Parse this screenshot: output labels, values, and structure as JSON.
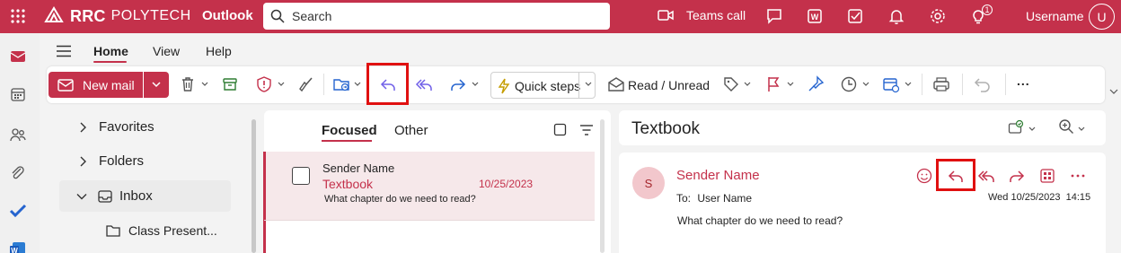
{
  "topbar": {
    "brand": "RRC",
    "brand_sub": "POLYTECH",
    "app_name": "Outlook",
    "search_placeholder": "Search",
    "teams_call": "Teams call",
    "notification_count": "1",
    "username": "Username",
    "avatar_initial": "U",
    "bg_color": "#c4314b"
  },
  "tabs": [
    {
      "label": "Home",
      "active": true
    },
    {
      "label": "View",
      "active": false
    },
    {
      "label": "Help",
      "active": false
    }
  ],
  "ribbon": {
    "new_mail": "New mail",
    "quick_steps": "Quick steps",
    "read_unread": "Read / Unread",
    "more": "..."
  },
  "nav": {
    "favorites": "Favorites",
    "folders": "Folders",
    "inbox": "Inbox",
    "subfolder": "Class Present..."
  },
  "message_list": {
    "tab_focused": "Focused",
    "tab_other": "Other",
    "messages": [
      {
        "sender": "Sender Name",
        "subject": "Textbook",
        "date": "10/25/2023",
        "preview": "What chapter do we need to read?"
      }
    ]
  },
  "reading_pane": {
    "subject": "Textbook",
    "sender_initial": "S",
    "sender_name": "Sender Name",
    "to_label": "To:",
    "to_name": "User Name",
    "datetime": "Wed 10/25/2023  14:15",
    "body": "What chapter do we need to read?"
  }
}
